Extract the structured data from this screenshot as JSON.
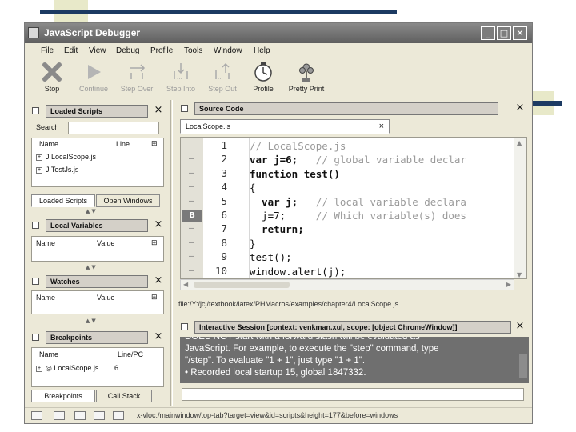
{
  "window": {
    "title": "JavaScript Debugger"
  },
  "menu": [
    "File",
    "Edit",
    "View",
    "Debug",
    "Profile",
    "Tools",
    "Window",
    "Help"
  ],
  "toolbar": {
    "stop": "Stop",
    "continue": "Continue",
    "step_over": "Step Over",
    "step_into": "Step Into",
    "step_out": "Step Out",
    "profile": "Profile",
    "pretty_print": "Pretty Print"
  },
  "loaded_scripts": {
    "title": "Loaded Scripts",
    "search_label": "Search",
    "search_value": "",
    "col_name": "Name",
    "col_line": "Line",
    "items": [
      "J LocalScope.js",
      "J TestJs.js"
    ],
    "tabs": [
      "Loaded Scripts",
      "Open Windows"
    ]
  },
  "local_variables": {
    "title": "Local Variables",
    "col_name": "Name",
    "col_value": "Value"
  },
  "watches": {
    "title": "Watches",
    "col_name": "Name",
    "col_value": "Value"
  },
  "breakpoints": {
    "title": "Breakpoints",
    "col_name": "Name",
    "col_line": "Line/PC",
    "items": [
      {
        "name": "LocalScope.js",
        "line": "6"
      }
    ],
    "tabs": [
      "Breakpoints",
      "Call Stack"
    ]
  },
  "source": {
    "title": "Source Code",
    "tab": "LocalScope.js",
    "lines": [
      {
        "num": "1",
        "mark": "",
        "text": "// LocalScope.js"
      },
      {
        "num": "2",
        "mark": "–",
        "text": "var j=6;   // global variable declar"
      },
      {
        "num": "3",
        "mark": "–",
        "text": "function test()"
      },
      {
        "num": "4",
        "mark": "–",
        "text": "{"
      },
      {
        "num": "5",
        "mark": "–",
        "text": "  var j;   // local variable declara"
      },
      {
        "num": "6",
        "mark": "B",
        "text": "  j=7;     // Which variable(s) does"
      },
      {
        "num": "7",
        "mark": "–",
        "text": "  return;"
      },
      {
        "num": "8",
        "mark": "–",
        "text": "}"
      },
      {
        "num": "9",
        "mark": "–",
        "text": "test();"
      },
      {
        "num": "10",
        "mark": "–",
        "text": "window.alert(j);"
      }
    ],
    "path": "file:/Y:/jcj/textbook/latex/PHMacros/examples/chapter4/LocalScope.js"
  },
  "session": {
    "title": "Interactive Session [context: venkman.xul, scope: [object ChromeWindow]]",
    "lines": [
      "DOES NOT start with a forward slash will be evaluated as",
      "JavaScript.  For example, to execute the \"step\" command, type",
      "\"/step\".  To evaluate \"1 + 1\", just type \"1 + 1\".",
      "• Recorded local startup 15, global 1847332."
    ],
    "input_value": ""
  },
  "status": {
    "text": "x-vloc:/mainwindow/top-tab?target=view&id=scripts&height=177&before=windows"
  },
  "colors": {
    "deco_bar": "#1c3a62",
    "deco_square": "#e8e9c9",
    "console_bg": "#6f6f6f"
  }
}
